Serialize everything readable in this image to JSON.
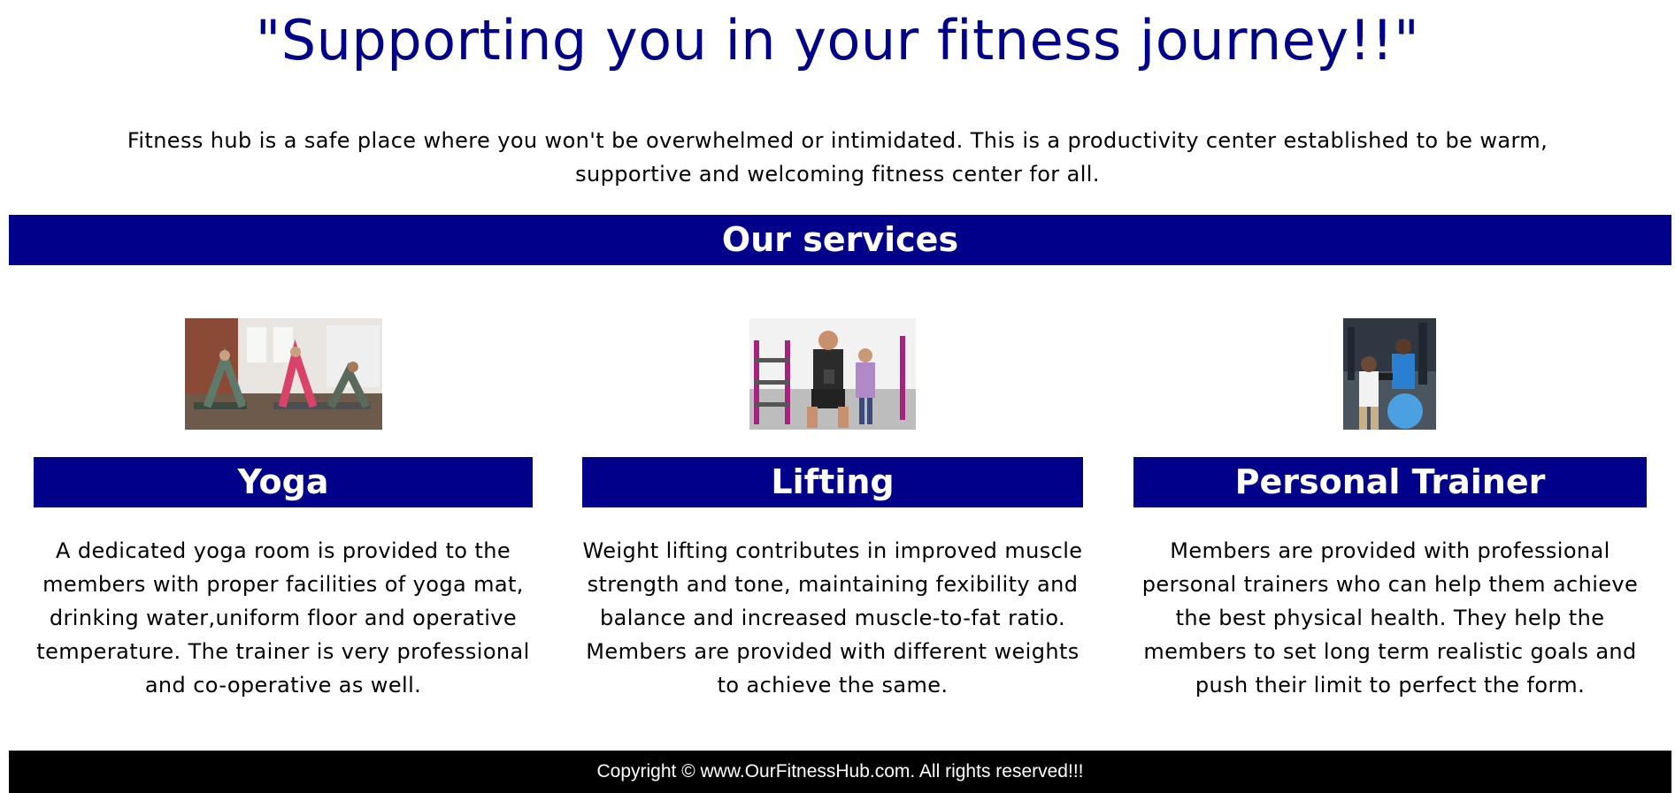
{
  "hero": {
    "title": "\"Supporting you in your fitness journey!!\"",
    "intro": "Fitness hub is a safe place where you won't be overwhelmed or intimidated. This is a productivity center established to be warm, supportive and welcoming fitness center for all."
  },
  "services": {
    "heading": "Our services",
    "items": [
      {
        "title": "Yoga",
        "description": "A dedicated yoga room is provided to the members with proper facilities of yoga mat, drinking water,uniform floor and operative temperature. The trainer is very professional and co-operative as well."
      },
      {
        "title": "Lifting",
        "description": "Weight lifting contributes in improved muscle strength and tone, maintaining fexibility and balance and increased muscle-to-fat ratio. Members are provided with different weights to achieve the same."
      },
      {
        "title": "Personal Trainer",
        "description": "Members are provided with professional personal trainers who can help them achieve the best physical health. They help the members to set long term realistic goals and push their limit to perfect the form."
      }
    ]
  },
  "footer": {
    "copyright": "Copyright © www.OurFitnessHub.com. All rights reserved!!!"
  },
  "colors": {
    "accent": "#00008b",
    "footer_bg": "#000000",
    "text": "#000000"
  }
}
